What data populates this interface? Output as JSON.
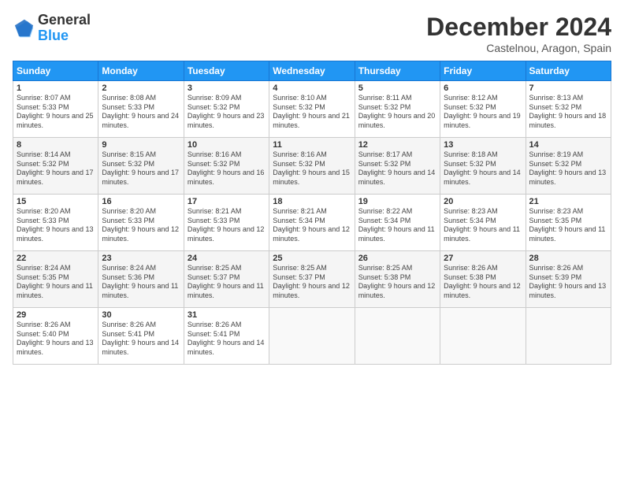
{
  "logo": {
    "line1": "General",
    "line2": "Blue"
  },
  "title": "December 2024",
  "location": "Castelnou, Aragon, Spain",
  "weekdays": [
    "Sunday",
    "Monday",
    "Tuesday",
    "Wednesday",
    "Thursday",
    "Friday",
    "Saturday"
  ],
  "weeks": [
    [
      {
        "day": "1",
        "sunrise": "8:07 AM",
        "sunset": "5:33 PM",
        "daylight": "9 hours and 25 minutes."
      },
      {
        "day": "2",
        "sunrise": "8:08 AM",
        "sunset": "5:33 PM",
        "daylight": "9 hours and 24 minutes."
      },
      {
        "day": "3",
        "sunrise": "8:09 AM",
        "sunset": "5:32 PM",
        "daylight": "9 hours and 23 minutes."
      },
      {
        "day": "4",
        "sunrise": "8:10 AM",
        "sunset": "5:32 PM",
        "daylight": "9 hours and 21 minutes."
      },
      {
        "day": "5",
        "sunrise": "8:11 AM",
        "sunset": "5:32 PM",
        "daylight": "9 hours and 20 minutes."
      },
      {
        "day": "6",
        "sunrise": "8:12 AM",
        "sunset": "5:32 PM",
        "daylight": "9 hours and 19 minutes."
      },
      {
        "day": "7",
        "sunrise": "8:13 AM",
        "sunset": "5:32 PM",
        "daylight": "9 hours and 18 minutes."
      }
    ],
    [
      {
        "day": "8",
        "sunrise": "8:14 AM",
        "sunset": "5:32 PM",
        "daylight": "9 hours and 17 minutes."
      },
      {
        "day": "9",
        "sunrise": "8:15 AM",
        "sunset": "5:32 PM",
        "daylight": "9 hours and 17 minutes."
      },
      {
        "day": "10",
        "sunrise": "8:16 AM",
        "sunset": "5:32 PM",
        "daylight": "9 hours and 16 minutes."
      },
      {
        "day": "11",
        "sunrise": "8:16 AM",
        "sunset": "5:32 PM",
        "daylight": "9 hours and 15 minutes."
      },
      {
        "day": "12",
        "sunrise": "8:17 AM",
        "sunset": "5:32 PM",
        "daylight": "9 hours and 14 minutes."
      },
      {
        "day": "13",
        "sunrise": "8:18 AM",
        "sunset": "5:32 PM",
        "daylight": "9 hours and 14 minutes."
      },
      {
        "day": "14",
        "sunrise": "8:19 AM",
        "sunset": "5:32 PM",
        "daylight": "9 hours and 13 minutes."
      }
    ],
    [
      {
        "day": "15",
        "sunrise": "8:20 AM",
        "sunset": "5:33 PM",
        "daylight": "9 hours and 13 minutes."
      },
      {
        "day": "16",
        "sunrise": "8:20 AM",
        "sunset": "5:33 PM",
        "daylight": "9 hours and 12 minutes."
      },
      {
        "day": "17",
        "sunrise": "8:21 AM",
        "sunset": "5:33 PM",
        "daylight": "9 hours and 12 minutes."
      },
      {
        "day": "18",
        "sunrise": "8:21 AM",
        "sunset": "5:34 PM",
        "daylight": "9 hours and 12 minutes."
      },
      {
        "day": "19",
        "sunrise": "8:22 AM",
        "sunset": "5:34 PM",
        "daylight": "9 hours and 11 minutes."
      },
      {
        "day": "20",
        "sunrise": "8:23 AM",
        "sunset": "5:34 PM",
        "daylight": "9 hours and 11 minutes."
      },
      {
        "day": "21",
        "sunrise": "8:23 AM",
        "sunset": "5:35 PM",
        "daylight": "9 hours and 11 minutes."
      }
    ],
    [
      {
        "day": "22",
        "sunrise": "8:24 AM",
        "sunset": "5:35 PM",
        "daylight": "9 hours and 11 minutes."
      },
      {
        "day": "23",
        "sunrise": "8:24 AM",
        "sunset": "5:36 PM",
        "daylight": "9 hours and 11 minutes."
      },
      {
        "day": "24",
        "sunrise": "8:25 AM",
        "sunset": "5:37 PM",
        "daylight": "9 hours and 11 minutes."
      },
      {
        "day": "25",
        "sunrise": "8:25 AM",
        "sunset": "5:37 PM",
        "daylight": "9 hours and 12 minutes."
      },
      {
        "day": "26",
        "sunrise": "8:25 AM",
        "sunset": "5:38 PM",
        "daylight": "9 hours and 12 minutes."
      },
      {
        "day": "27",
        "sunrise": "8:26 AM",
        "sunset": "5:38 PM",
        "daylight": "9 hours and 12 minutes."
      },
      {
        "day": "28",
        "sunrise": "8:26 AM",
        "sunset": "5:39 PM",
        "daylight": "9 hours and 13 minutes."
      }
    ],
    [
      {
        "day": "29",
        "sunrise": "8:26 AM",
        "sunset": "5:40 PM",
        "daylight": "9 hours and 13 minutes."
      },
      {
        "day": "30",
        "sunrise": "8:26 AM",
        "sunset": "5:41 PM",
        "daylight": "9 hours and 14 minutes."
      },
      {
        "day": "31",
        "sunrise": "8:26 AM",
        "sunset": "5:41 PM",
        "daylight": "9 hours and 14 minutes."
      },
      null,
      null,
      null,
      null
    ]
  ],
  "labels": {
    "sunrise": "Sunrise:",
    "sunset": "Sunset:",
    "daylight": "Daylight:"
  }
}
